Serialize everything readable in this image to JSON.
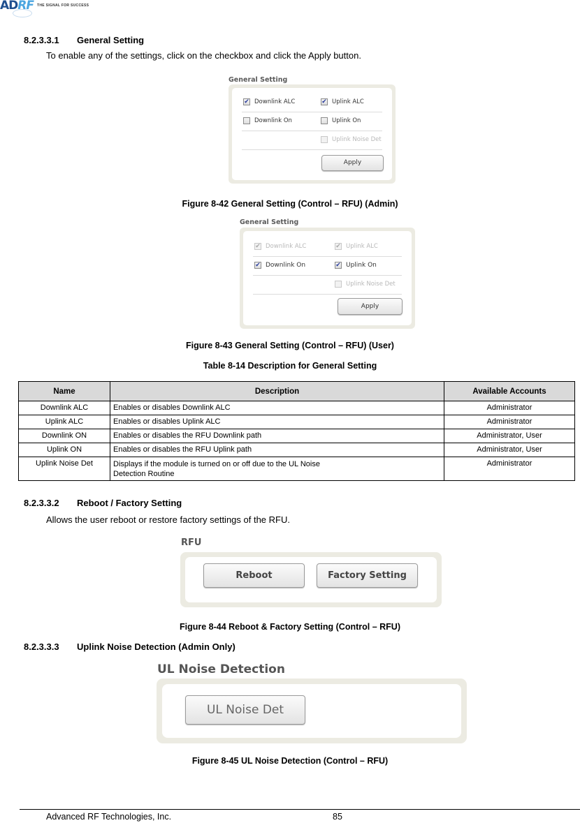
{
  "header": {
    "logo_ad": "AD",
    "logo_rf": "RF",
    "tagline": "THE SIGNAL FOR SUCCESS"
  },
  "sections": {
    "general": {
      "number": "8.2.3.3.1",
      "title": "General Setting",
      "intro": "To enable any of the settings, click on the checkbox and click the Apply button."
    },
    "reboot": {
      "number": "8.2.3.3.2",
      "title": "Reboot / Factory Setting",
      "intro": "Allows the user reboot or restore factory settings of the RFU."
    },
    "noise": {
      "number": "8.2.3.3.3",
      "title": "Uplink Noise Detection (Admin Only)"
    }
  },
  "figure_admin": {
    "panel_title": "General Setting",
    "checkboxes": [
      {
        "label": "Downlink ALC",
        "checked": true,
        "disabled": false
      },
      {
        "label": "Uplink ALC",
        "checked": true,
        "disabled": false
      },
      {
        "label": "Downlink On",
        "checked": false,
        "disabled": false
      },
      {
        "label": "Uplink On",
        "checked": false,
        "disabled": false
      },
      {
        "label": "Uplink Noise Det",
        "checked": false,
        "disabled": true
      }
    ],
    "apply_label": "Apply",
    "caption": "Figure 8-42    General Setting (Control – RFU) (Admin)"
  },
  "figure_user": {
    "panel_title": "General Setting",
    "checkboxes": [
      {
        "label": "Downlink ALC",
        "checked": true,
        "disabled": true
      },
      {
        "label": "Uplink ALC",
        "checked": true,
        "disabled": true
      },
      {
        "label": "Downlink On",
        "checked": true,
        "disabled": false
      },
      {
        "label": "Uplink On",
        "checked": true,
        "disabled": false
      },
      {
        "label": "Uplink Noise Det",
        "checked": false,
        "disabled": true
      }
    ],
    "apply_label": "Apply",
    "caption": "Figure 8-43    General Setting (Control – RFU) (User)"
  },
  "table": {
    "caption": "Table 8-14     Description for General Setting",
    "headers": [
      "Name",
      "Description",
      "Available Accounts"
    ],
    "rows": [
      [
        "Downlink ALC",
        "Enables or disables Downlink ALC",
        "Administrator"
      ],
      [
        "Uplink ALC",
        "Enables or disables Uplink ALC",
        "Administrator"
      ],
      [
        "Downlink ON",
        "Enables or disables the RFU Downlink path",
        "Administrator, User"
      ],
      [
        "Uplink ON",
        "Enables or disables the RFU Uplink path",
        "Administrator, User"
      ],
      [
        "Uplink Noise Det",
        "Displays if the module is turned on or off due to the UL Noise Detection Routine",
        "Administrator"
      ]
    ]
  },
  "figure_reboot": {
    "panel_title": "RFU",
    "reboot_label": "Reboot",
    "factory_label": "Factory Setting",
    "caption": "Figure 8-44    Reboot & Factory Setting (Control – RFU)"
  },
  "figure_noise": {
    "panel_title": "UL Noise Detection",
    "button_label": "UL Noise Det",
    "caption": "Figure 8-45    UL Noise Detection (Control – RFU)"
  },
  "footer": {
    "company": "Advanced RF Technologies, Inc.",
    "page_number": "85"
  }
}
